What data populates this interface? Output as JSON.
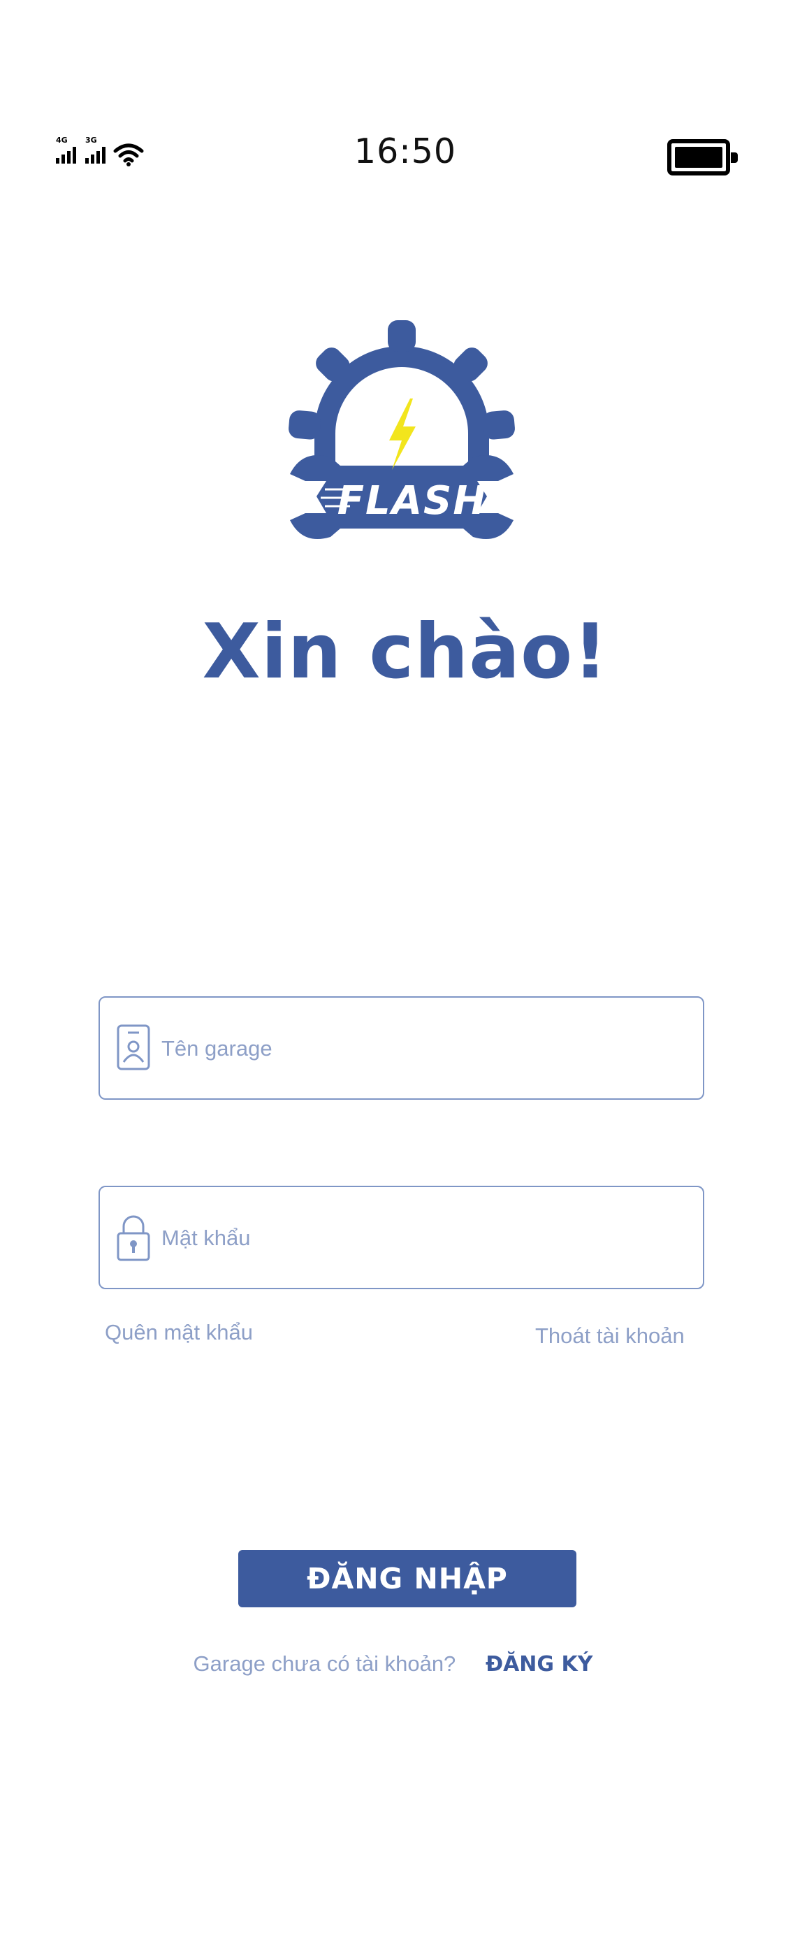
{
  "status_bar": {
    "time": "16:50",
    "signal_1_label": "4G",
    "signal_2_label": "3G",
    "icons": [
      "cellular-signal-icon",
      "cellular-signal-icon",
      "wifi-icon",
      "battery-icon"
    ]
  },
  "logo": {
    "text": "FLASH",
    "primary_color": "#3d5b9e",
    "bolt_color": "#f2e51d"
  },
  "greeting": "Xin chào!",
  "form": {
    "username_placeholder": "Tên garage",
    "password_placeholder": "Mật khẩu",
    "username_icon": "id-card-icon",
    "password_icon": "lock-icon",
    "forgot_password": "Quên mật khẩu",
    "exit_account": "Thoát tài khoản",
    "login_button": "ĐĂNG NHẬP"
  },
  "register": {
    "question": "Garage chưa có tài khoản?",
    "link": "ĐĂNG KÝ"
  },
  "colors": {
    "brand": "#3d5b9e",
    "muted_text": "#8d9fc7",
    "border": "#7f96c6"
  }
}
